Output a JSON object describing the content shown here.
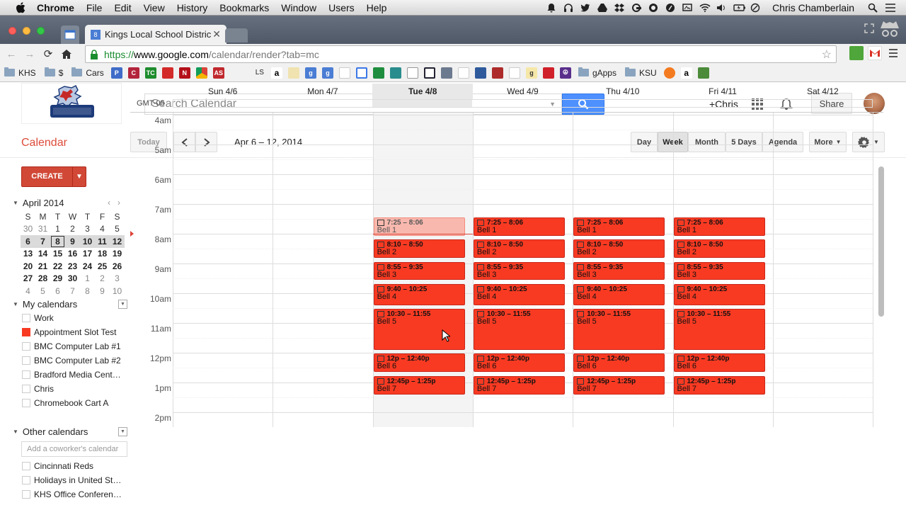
{
  "mac_menu": {
    "app": "Chrome",
    "items": [
      "File",
      "Edit",
      "View",
      "History",
      "Bookmarks",
      "Window",
      "Users",
      "Help"
    ],
    "user": "Chris Chamberlain"
  },
  "browser": {
    "tab_title": "Kings Local School Distric",
    "tab_favicon": "8",
    "url_scheme": "https://",
    "url_host": "www.google.com",
    "url_path": "/calendar/render?tab=mc"
  },
  "bookmarks": {
    "folder_khs": "KHS",
    "folder_dollar": "$",
    "folder_cars": "Cars",
    "ls": "LS",
    "folder_gapps": "gApps",
    "folder_ksu": "KSU"
  },
  "header": {
    "search_placeholder": "Search Calendar",
    "plus_user": "+Chris",
    "share_label": "Share"
  },
  "toolbar": {
    "title": "Calendar",
    "today": "Today",
    "date_range": "Apr 6 – 12, 2014",
    "views": {
      "day": "Day",
      "week": "Week",
      "month": "Month",
      "five_days": "5 Days",
      "agenda": "Agenda",
      "more": "More"
    }
  },
  "sidebar": {
    "create_label": "CREATE",
    "mini_month": "April 2014",
    "weekday_letters": [
      "S",
      "M",
      "T",
      "W",
      "T",
      "F",
      "S"
    ],
    "weeks": [
      [
        "30",
        "31",
        "1",
        "2",
        "3",
        "4",
        "5"
      ],
      [
        "6",
        "7",
        "8",
        "9",
        "10",
        "11",
        "12"
      ],
      [
        "13",
        "14",
        "15",
        "16",
        "17",
        "18",
        "19"
      ],
      [
        "20",
        "21",
        "22",
        "23",
        "24",
        "25",
        "26"
      ],
      [
        "27",
        "28",
        "29",
        "30",
        "1",
        "2",
        "3"
      ],
      [
        "4",
        "5",
        "6",
        "7",
        "8",
        "9",
        "10"
      ]
    ],
    "my_calendars_label": "My calendars",
    "my_calendars": [
      {
        "name": "Work",
        "checked": false
      },
      {
        "name": "Appointment Slot Test",
        "checked": true
      },
      {
        "name": "BMC Computer Lab #1",
        "checked": false
      },
      {
        "name": "BMC Computer Lab #2",
        "checked": false
      },
      {
        "name": "Bradford Media Cent…",
        "checked": false
      },
      {
        "name": "Chris",
        "checked": false
      },
      {
        "name": "Chromebook Cart A",
        "checked": false
      }
    ],
    "other_calendars_label": "Other calendars",
    "add_coworker_placeholder": "Add a coworker's calendar",
    "other_calendars": [
      {
        "name": "Cincinnati Reds",
        "checked": false
      },
      {
        "name": "Holidays in United St…",
        "checked": false
      },
      {
        "name": "KHS Office Conferen…",
        "checked": false
      }
    ]
  },
  "week": {
    "timezone": "GMT-05",
    "days": [
      "Sun 4/6",
      "Mon 4/7",
      "Tue 4/8",
      "Wed 4/9",
      "Thu 4/10",
      "Fri 4/11",
      "Sat 4/12"
    ],
    "today_index": 2,
    "hours": [
      "4am",
      "5am",
      "6am",
      "7am",
      "8am",
      "9am",
      "10am",
      "11am",
      "12pm",
      "1pm",
      "2pm"
    ],
    "first_hour": 4,
    "now_hour": 8.0
  },
  "events": [
    {
      "day": 2,
      "time": "7:25 – 8:06",
      "title": "Bell 1",
      "start": 7.4167,
      "end": 8.1,
      "past": true
    },
    {
      "day": 3,
      "time": "7:25 – 8:06",
      "title": "Bell 1",
      "start": 7.4167,
      "end": 8.1,
      "past": false
    },
    {
      "day": 4,
      "time": "7:25 – 8:06",
      "title": "Bell 1",
      "start": 7.4167,
      "end": 8.1,
      "past": false
    },
    {
      "day": 5,
      "time": "7:25 – 8:06",
      "title": "Bell 1",
      "start": 7.4167,
      "end": 8.1,
      "past": false
    },
    {
      "day": 2,
      "time": "8:10 – 8:50",
      "title": "Bell 2",
      "start": 8.1667,
      "end": 8.8333,
      "past": false
    },
    {
      "day": 3,
      "time": "8:10 – 8:50",
      "title": "Bell 2",
      "start": 8.1667,
      "end": 8.8333,
      "past": false
    },
    {
      "day": 4,
      "time": "8:10 – 8:50",
      "title": "Bell 2",
      "start": 8.1667,
      "end": 8.8333,
      "past": false
    },
    {
      "day": 5,
      "time": "8:10 – 8:50",
      "title": "Bell 2",
      "start": 8.1667,
      "end": 8.8333,
      "past": false
    },
    {
      "day": 2,
      "time": "8:55 – 9:35",
      "title": "Bell 3",
      "start": 8.9167,
      "end": 9.5833,
      "past": false
    },
    {
      "day": 3,
      "time": "8:55 – 9:35",
      "title": "Bell 3",
      "start": 8.9167,
      "end": 9.5833,
      "past": false
    },
    {
      "day": 4,
      "time": "8:55 – 9:35",
      "title": "Bell 3",
      "start": 8.9167,
      "end": 9.5833,
      "past": false
    },
    {
      "day": 5,
      "time": "8:55 – 9:35",
      "title": "Bell 3",
      "start": 8.9167,
      "end": 9.5833,
      "past": false
    },
    {
      "day": 2,
      "time": "9:40 – 10:25",
      "title": "Bell 4",
      "start": 9.6667,
      "end": 10.4167,
      "past": false
    },
    {
      "day": 3,
      "time": "9:40 – 10:25",
      "title": "Bell 4",
      "start": 9.6667,
      "end": 10.4167,
      "past": false
    },
    {
      "day": 4,
      "time": "9:40 – 10:25",
      "title": "Bell 4",
      "start": 9.6667,
      "end": 10.4167,
      "past": false
    },
    {
      "day": 5,
      "time": "9:40 – 10:25",
      "title": "Bell 4",
      "start": 9.6667,
      "end": 10.4167,
      "past": false
    },
    {
      "day": 2,
      "time": "10:30 – 11:55",
      "title": "Bell 5",
      "start": 10.5,
      "end": 11.9167,
      "past": false
    },
    {
      "day": 3,
      "time": "10:30 – 11:55",
      "title": "Bell 5",
      "start": 10.5,
      "end": 11.9167,
      "past": false
    },
    {
      "day": 4,
      "time": "10:30 – 11:55",
      "title": "Bell 5",
      "start": 10.5,
      "end": 11.9167,
      "past": false
    },
    {
      "day": 5,
      "time": "10:30 – 11:55",
      "title": "Bell 5",
      "start": 10.5,
      "end": 11.9167,
      "past": false
    },
    {
      "day": 2,
      "time": "12p – 12:40p",
      "title": "Bell 6",
      "start": 12.0,
      "end": 12.6667,
      "past": false
    },
    {
      "day": 3,
      "time": "12p – 12:40p",
      "title": "Bell 6",
      "start": 12.0,
      "end": 12.6667,
      "past": false
    },
    {
      "day": 4,
      "time": "12p – 12:40p",
      "title": "Bell 6",
      "start": 12.0,
      "end": 12.6667,
      "past": false
    },
    {
      "day": 5,
      "time": "12p – 12:40p",
      "title": "Bell 6",
      "start": 12.0,
      "end": 12.6667,
      "past": false
    },
    {
      "day": 2,
      "time": "12:45p – 1:25p",
      "title": "Bell 7",
      "start": 12.75,
      "end": 13.4167,
      "past": false
    },
    {
      "day": 3,
      "time": "12:45p – 1:25p",
      "title": "Bell 7",
      "start": 12.75,
      "end": 13.4167,
      "past": false
    },
    {
      "day": 4,
      "time": "12:45p – 1:25p",
      "title": "Bell 7",
      "start": 12.75,
      "end": 13.4167,
      "past": false
    },
    {
      "day": 5,
      "time": "12:45p – 1:25p",
      "title": "Bell 7",
      "start": 12.75,
      "end": 13.4167,
      "past": false
    }
  ],
  "colors": {
    "event": "#f83a22",
    "accent": "#dd4b39",
    "create": "#d14836",
    "search_button": "#4d90fe"
  }
}
